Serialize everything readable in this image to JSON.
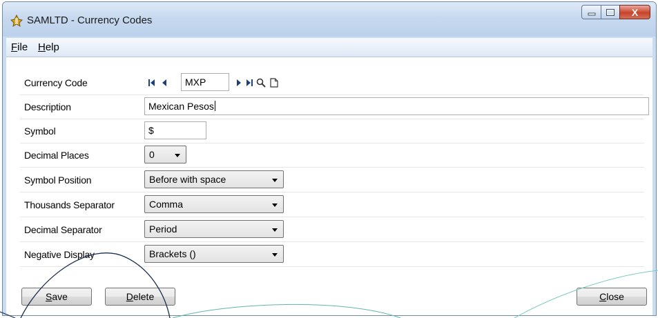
{
  "window": {
    "title": "SAMLTD - Currency Codes",
    "caption_close_glyph": "X"
  },
  "menu": {
    "file_rest": "ile",
    "file_key": "F",
    "help_rest": "elp",
    "help_key": "H"
  },
  "form": {
    "currency_code": {
      "label": "Currency Code",
      "value": "MXP"
    },
    "description": {
      "label": "Description",
      "value": "Mexican Pesos"
    },
    "symbol": {
      "label": "Symbol",
      "value": "$"
    },
    "decimal_places": {
      "label": "Decimal Places",
      "value": "0"
    },
    "symbol_position": {
      "label": "Symbol Position",
      "value": "Before with space"
    },
    "thousands_separator": {
      "label": "Thousands Separator",
      "value": "Comma"
    },
    "decimal_separator": {
      "label": "Decimal Separator",
      "value": "Period"
    },
    "negative_display": {
      "label": "Negative Display",
      "value": "Brackets ()"
    }
  },
  "buttons": {
    "save_key": "S",
    "save_rest": "ave",
    "delete_key": "D",
    "delete_rest": "elete",
    "close_key": "C",
    "close_rest": "lose"
  },
  "icons": {
    "app": "app-icon",
    "first": "first-record-icon",
    "prev": "previous-record-icon",
    "next": "next-record-icon",
    "last": "last-record-icon",
    "search": "search-icon",
    "new": "new-record-icon"
  },
  "colors": {
    "window_frame": "#c9dcf2",
    "nav_icon": "#1f3f78",
    "close_button": "#c9442b"
  }
}
